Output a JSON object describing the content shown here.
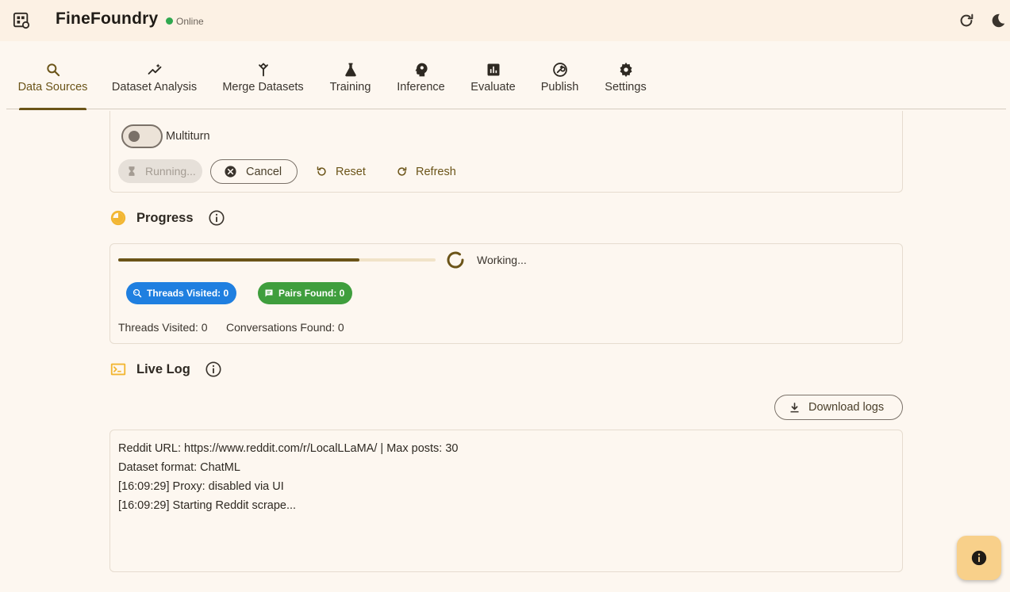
{
  "app": {
    "title": "FineFoundry",
    "status": "Online",
    "status_color": "#2fa84f"
  },
  "tabs": [
    {
      "label": "Data Sources",
      "icon": "search-icon",
      "active": true
    },
    {
      "label": "Dataset Analysis",
      "icon": "analytics-icon"
    },
    {
      "label": "Merge Datasets",
      "icon": "merge-icon"
    },
    {
      "label": "Training",
      "icon": "flask-icon"
    },
    {
      "label": "Inference",
      "icon": "brain-head-icon"
    },
    {
      "label": "Evaluate",
      "icon": "bar-chart-icon"
    },
    {
      "label": "Publish",
      "icon": "wrench-circle-icon"
    },
    {
      "label": "Settings",
      "icon": "gear-icon"
    }
  ],
  "controls": {
    "multiturn_label": "Multiturn",
    "multiturn_on": false,
    "running_label": "Running...",
    "cancel_label": "Cancel",
    "reset_label": "Reset",
    "refresh_label": "Refresh"
  },
  "progress": {
    "title": "Progress",
    "fraction": 0.76,
    "working_text": "Working...",
    "chip_threads": "Threads Visited: 0",
    "chip_pairs": "Pairs Found: 0",
    "threads_visited": "Threads Visited: 0",
    "conversations_found": "Conversations Found: 0"
  },
  "live_log": {
    "title": "Live Log",
    "download_label": "Download logs",
    "lines": [
      "Reddit URL: https://www.reddit.com/r/LocalLLaMA/ | Max posts: 30",
      "Dataset format: ChatML",
      "[16:09:29] Proxy: disabled via UI",
      "[16:09:29] Starting Reddit scrape..."
    ]
  },
  "colors": {
    "accent": "#6b5418",
    "background": "#fdf7f0",
    "topbar": "#fcf1e4",
    "chip_blue": "#1f7fe0",
    "chip_green": "#3f9e3d",
    "fab": "#f8d08a"
  }
}
